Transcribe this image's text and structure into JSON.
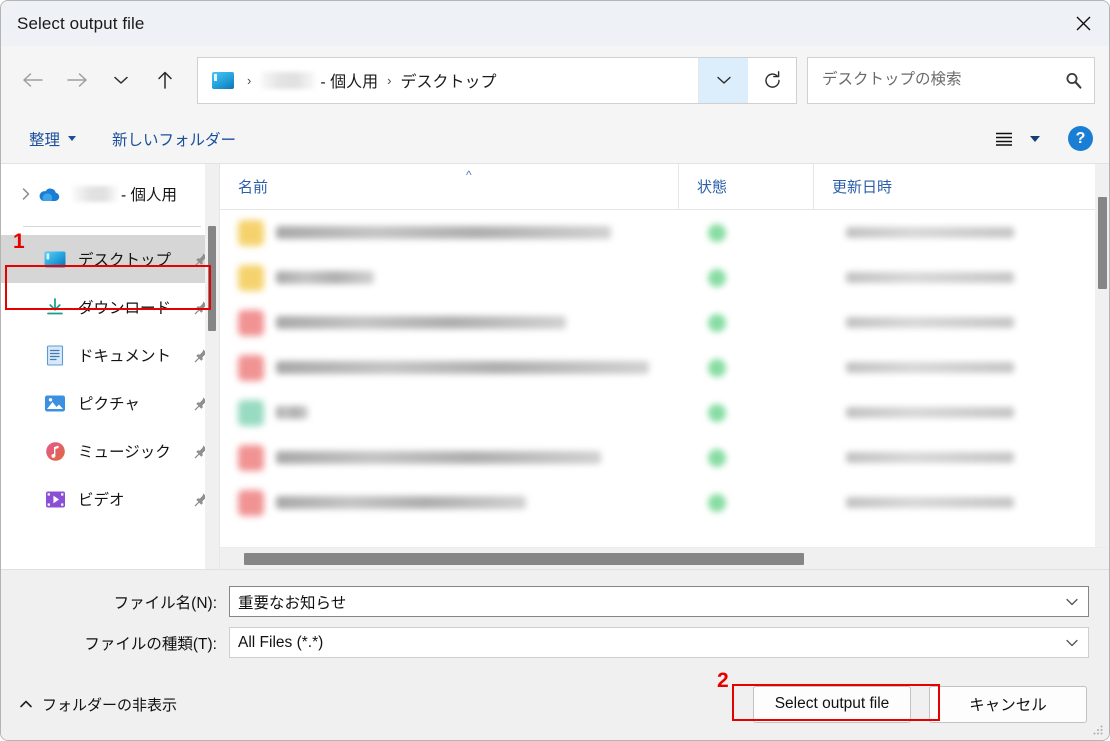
{
  "window": {
    "title": "Select output file",
    "close_label": "×"
  },
  "nav": {
    "back": "back-arrow",
    "forward": "forward-arrow",
    "recent": "chevron-down",
    "up": "up-arrow",
    "refresh": "refresh",
    "dropdown": "chevron-down"
  },
  "breadcrumb": {
    "root_icon": "desktop-icon",
    "redacted": "",
    "items": [
      "- 個人用",
      "デスクトップ"
    ],
    "separator": "›"
  },
  "search": {
    "placeholder": "デスクトップの検索",
    "value": "",
    "icon": "search-icon"
  },
  "commandbar": {
    "organize_label": "整理",
    "new_folder_label": "新しいフォルダー",
    "view_icon": "list-view-icon",
    "help_label": "?"
  },
  "sidebar": {
    "onedrive": {
      "label": "- 個人用",
      "icon": "onedrive-cloud-icon",
      "chevron": "chevron-right"
    },
    "items": [
      {
        "label": "デスクトップ",
        "icon": "desktop-icon",
        "pinned": true,
        "selected": true
      },
      {
        "label": "ダウンロード",
        "icon": "download-icon",
        "pinned": true,
        "selected": false
      },
      {
        "label": "ドキュメント",
        "icon": "document-icon",
        "pinned": true,
        "selected": false
      },
      {
        "label": "ピクチャ",
        "icon": "picture-icon",
        "pinned": true,
        "selected": false
      },
      {
        "label": "ミュージック",
        "icon": "music-icon",
        "pinned": true,
        "selected": false
      },
      {
        "label": "ビデオ",
        "icon": "video-icon",
        "pinned": true,
        "selected": false
      }
    ]
  },
  "filelist": {
    "columns": [
      "名前",
      "状態",
      "更新日時"
    ],
    "sort_indicator": "^",
    "rows": [
      {
        "icon_color": "#f5cf61",
        "name_width": 335,
        "redacted": true
      },
      {
        "icon_color": "#f5cf61",
        "name_width": 98,
        "redacted": true
      },
      {
        "icon_color": "#f08a8a",
        "name_width": 290,
        "redacted": true
      },
      {
        "icon_color": "#f08a8a",
        "name_width": 373,
        "redacted": true
      },
      {
        "icon_color": "#8fd8bd",
        "name_width": 32,
        "redacted": true
      },
      {
        "icon_color": "#f08a8a",
        "name_width": 325,
        "redacted": true
      },
      {
        "icon_color": "#f08a8a",
        "name_width": 250,
        "redacted": true
      }
    ]
  },
  "form": {
    "filename_label": "ファイル名(N):",
    "filename_value": "重要なお知らせ",
    "filetype_label": "ファイルの種類(T):",
    "filetype_value": "All Files (*.*)"
  },
  "actions": {
    "folder_toggle_label": "フォルダーの非表示",
    "folder_toggle_icon": "chevron-up",
    "primary_label": "Select output file",
    "cancel_label": "キャンセル"
  },
  "annotations": [
    {
      "number": "1"
    },
    {
      "number": "2"
    }
  ],
  "colors": {
    "annotation": "#e60000",
    "accent": "#1a7fd4",
    "command_text": "#1b4f9c",
    "column_header": "#2c5fa8"
  }
}
